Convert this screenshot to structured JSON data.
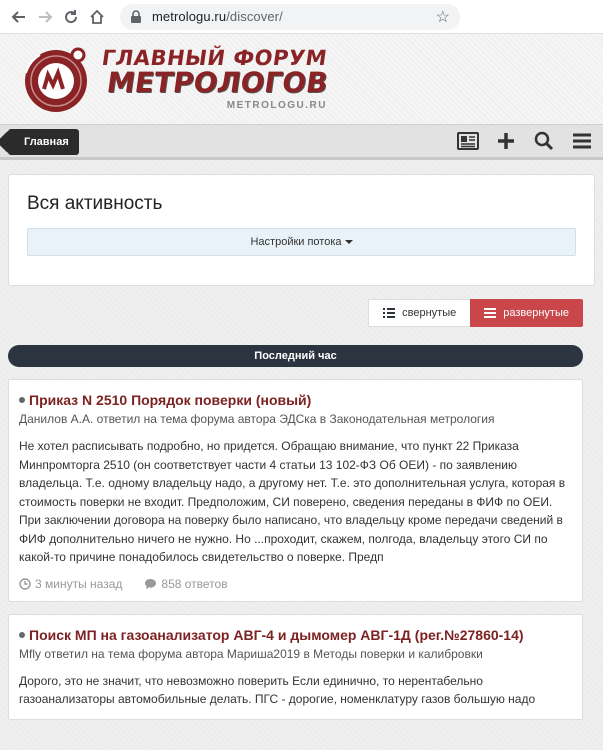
{
  "browser": {
    "url_host": "metrologu.ru",
    "url_path": "/discover/"
  },
  "logo": {
    "line1": "ГЛАВНЫЙ ФОРУМ",
    "line2": "МЕТРОЛОГОВ",
    "line3": "METROLOGU.RU"
  },
  "nav": {
    "home_label": "Главная"
  },
  "activity": {
    "title": "Вся активность",
    "stream_settings": "Настройки потока"
  },
  "view_toggle": {
    "collapsed": "свернутые",
    "expanded": "развернутые"
  },
  "time_bar": "Последний час",
  "posts": [
    {
      "title": "Приказ N 2510 Порядок поверки (новый)",
      "meta": "Данилов А.А. ответил на тема форума автора ЭДСка в Законодательная метрология",
      "text": "Не хотел расписывать подробно, но придется. Обращаю внимание, что пункт 22 Приказа Минпромторга 2510 (он соответствует части 4 статьи 13 102-ФЗ Об ОЕИ) - по заявлению владельца. Т.е. одному владельцу надо, а другому нет. Т.е. это дополнительная услуга, которая в стоимость поверки не входит. Предположим, СИ поверено, сведения переданы в ФИФ по ОЕИ. При заключении договора на поверку было написано, что владельцу кроме передачи сведений в ФИФ дополнительно ничего не нужно. Но ...проходит, скажем, полгода, владельцу этого СИ по какой-то причине понадобилось свидетельство о поверке. Предп",
      "time": "3 минуты назад",
      "replies": "858 ответов"
    },
    {
      "title": "Поиск МП на газоанализатор АВГ-4 и дымомер АВГ-1Д (рег.№27860-14)",
      "meta": "Mfly ответил на тема форума автора Мариша2019 в Методы поверки и калибровки",
      "text": "Дорого, это не значит, что невозможно поверить Если единично, то нерентабельно газоанализаторы автомобильные делать. ПГС - дорогие, номенклатуру газов большую надо"
    }
  ],
  "colors": {
    "brand": "#8a2325",
    "accent_red": "#c9474b",
    "dark_bar": "#2c3440"
  }
}
